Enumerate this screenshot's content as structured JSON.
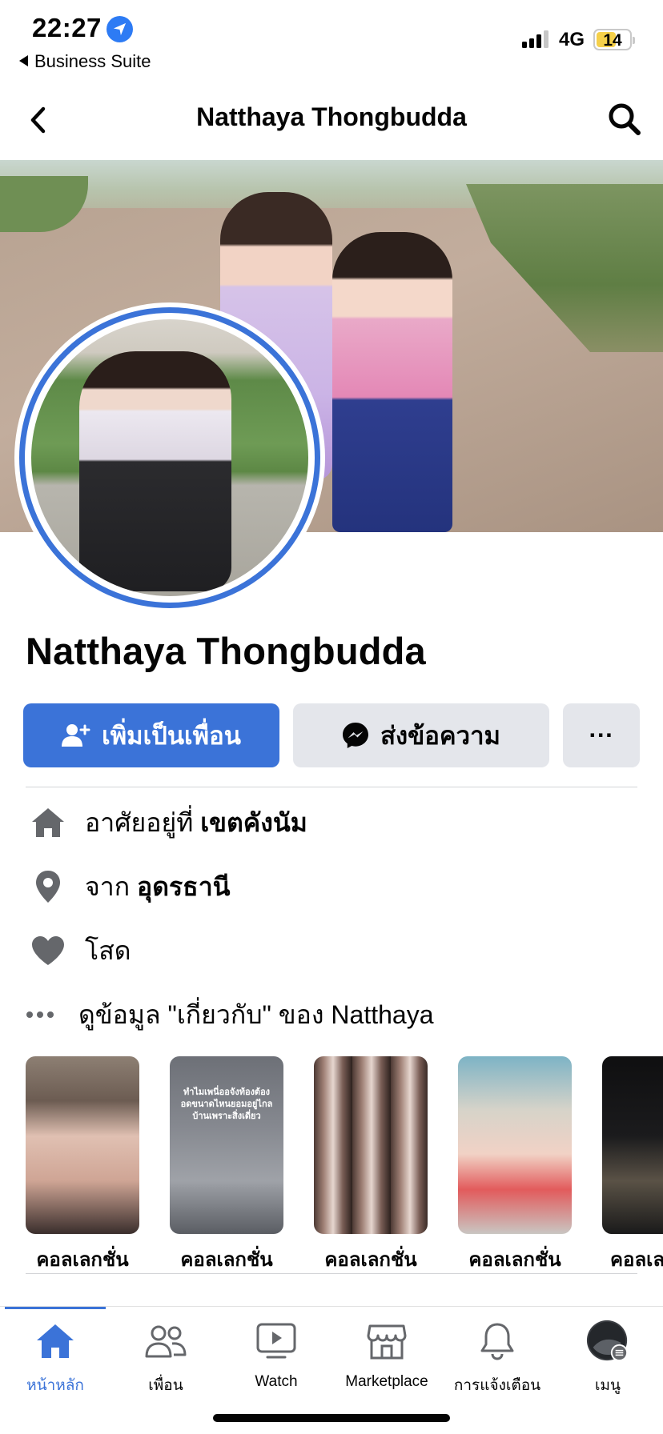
{
  "status_bar": {
    "time": "22:27",
    "back_app": "Business Suite",
    "network": "4G",
    "battery": "14",
    "battery_color": "#f5d04a"
  },
  "header": {
    "title": "Natthaya Thongbudda",
    "back_icon": "chevron-left-icon",
    "search_icon": "search-icon"
  },
  "profile": {
    "name": "Natthaya Thongbudda"
  },
  "actions": {
    "add_friend": "เพิ่มเป็นเพื่อน",
    "message": "ส่งข้อความ",
    "more": "···"
  },
  "info": {
    "lives_prefix": "อาศัยอยู่ที่",
    "lives_value": "เขตคังนัม",
    "from_prefix": "จาก",
    "from_value": "อุดรธานี",
    "relationship": "โสด",
    "about_link": "ดูข้อมูล \"เกี่ยวกับ\" ของ Natthaya"
  },
  "collections": {
    "items": [
      {
        "label": "คอลเลกชั่น"
      },
      {
        "label": "คอลเลกชั่น",
        "thumb_text": "ทำไมเพนี่ออจังท้องต้องอดขนาดไหนยอมอยู่ไกลบ้านเพราะสิ่งเดี่ยว"
      },
      {
        "label": "คอลเลกชั่น"
      },
      {
        "label": "คอลเลกชั่น"
      },
      {
        "label": "คอลเลกชั่น"
      }
    ]
  },
  "tabs": [
    {
      "label": "หน้าหลัก",
      "icon": "home-icon",
      "active": true
    },
    {
      "label": "เพื่อน",
      "icon": "friends-icon",
      "active": false
    },
    {
      "label": "Watch",
      "icon": "watch-icon",
      "active": false
    },
    {
      "label": "Marketplace",
      "icon": "marketplace-icon",
      "active": false
    },
    {
      "label": "การแจ้งเตือน",
      "icon": "bell-icon",
      "active": false
    },
    {
      "label": "เมนู",
      "icon": "menu-avatar-icon",
      "active": false
    }
  ],
  "colors": {
    "brand_blue": "#3b73d8",
    "button_gray": "#e4e6eb",
    "icon_gray": "#65676b"
  }
}
